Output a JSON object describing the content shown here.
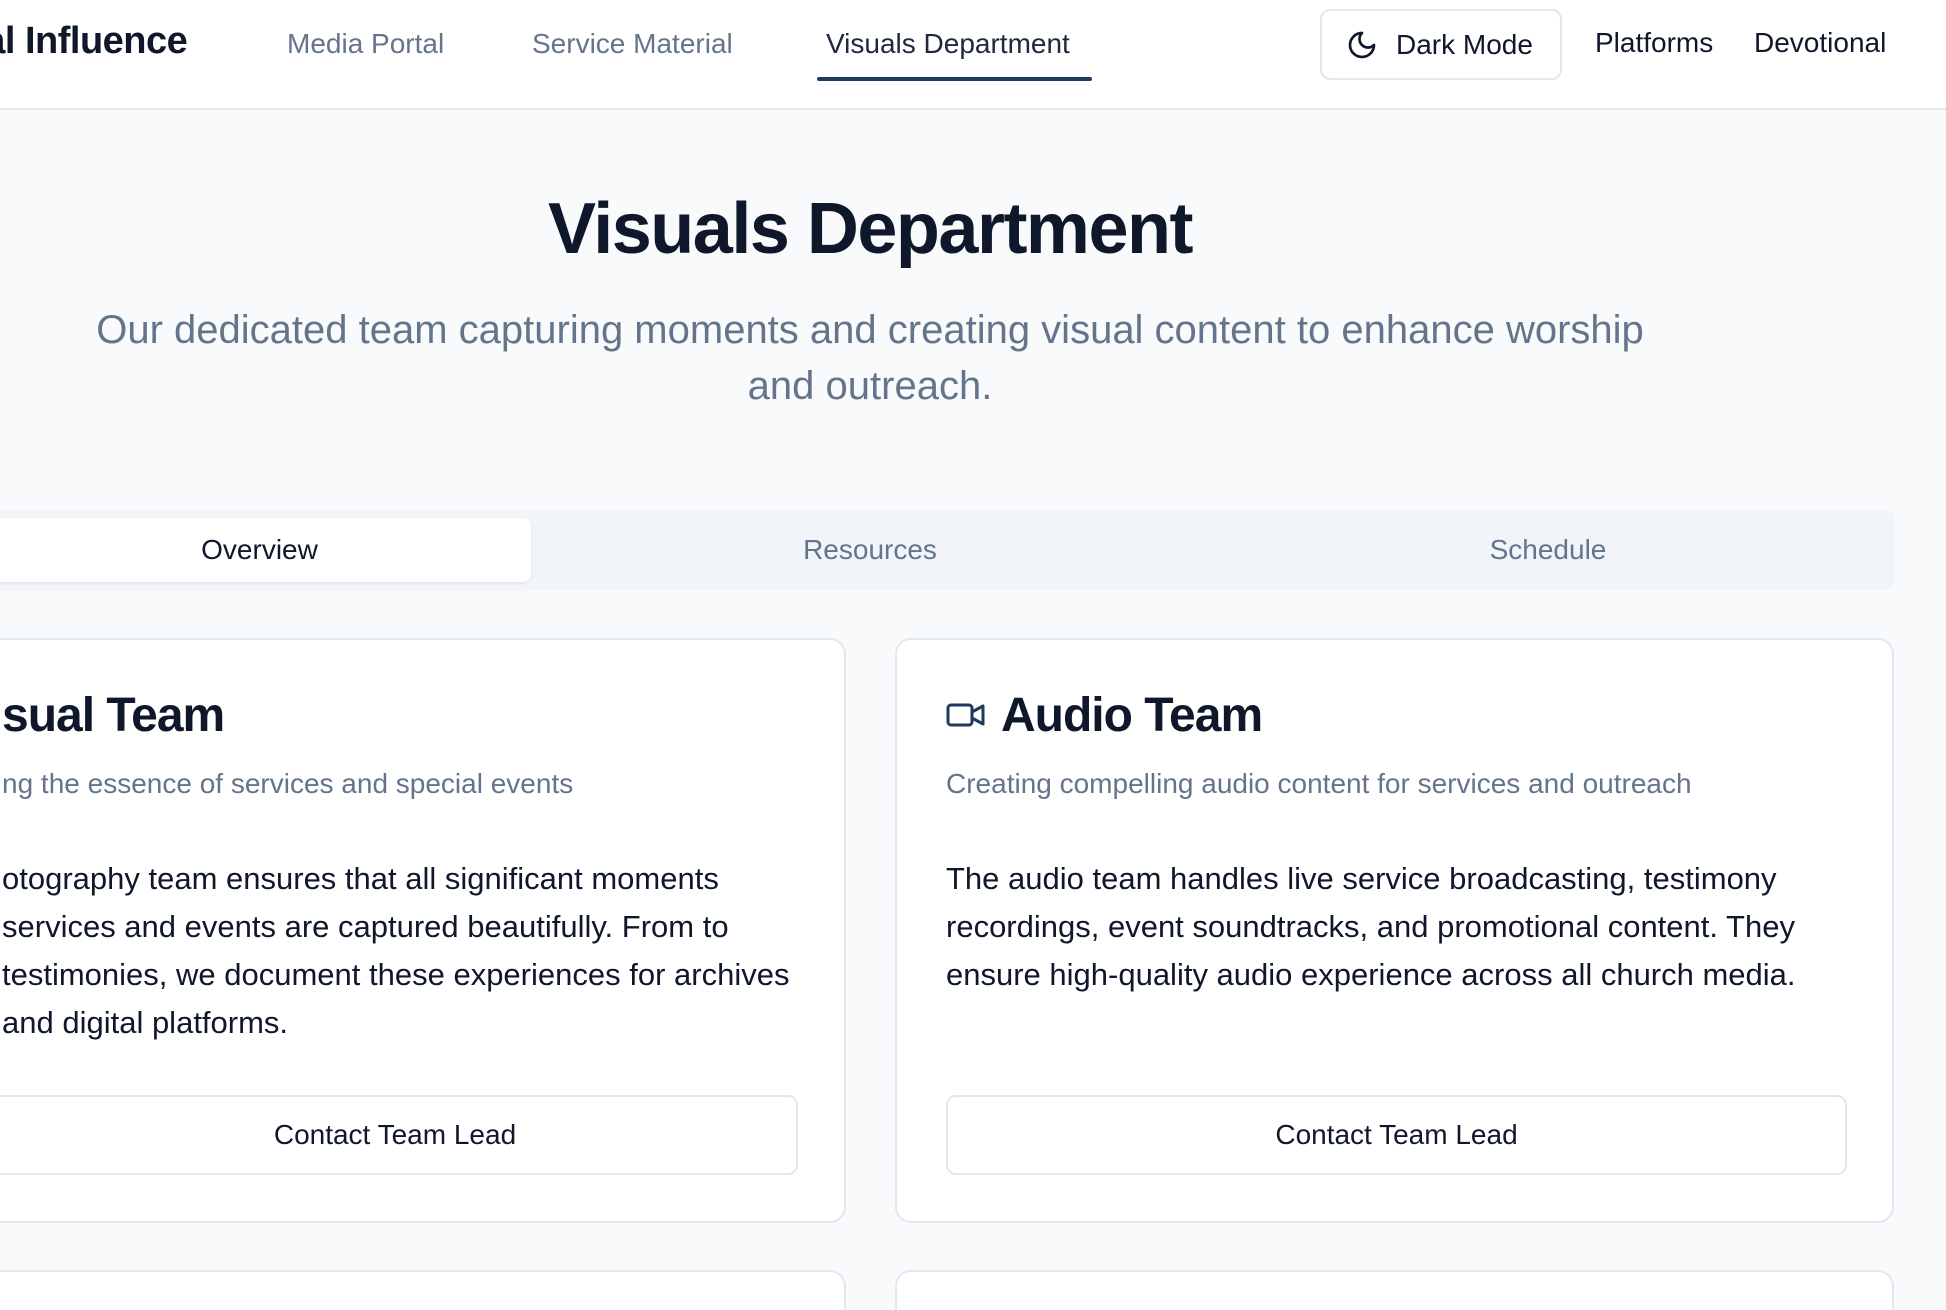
{
  "header": {
    "brand": "ital Influence",
    "nav": [
      {
        "label": "Media Portal"
      },
      {
        "label": "Service Material"
      },
      {
        "label": "Visuals Department"
      }
    ],
    "active_nav": "Visuals Department",
    "dark_mode_label": "Dark Mode",
    "links": [
      {
        "label": "Platforms"
      },
      {
        "label": "Devotional"
      }
    ]
  },
  "hero": {
    "title": "Visuals Department",
    "subtitle": "Our dedicated team capturing moments and creating visual content to enhance worship and outreach."
  },
  "tabs": [
    {
      "label": "Overview"
    },
    {
      "label": "Resources"
    },
    {
      "label": "Schedule"
    }
  ],
  "active_tab": "Overview",
  "cards": [
    {
      "title": "sual Team",
      "subtitle": "ng the essence of services and special events",
      "body": "otography team ensures that all significant moments services and events are captured beautifully. From to testimonies, we document these experiences for archives and digital platforms.",
      "button": "Contact Team Lead"
    },
    {
      "icon": "video-camera-icon",
      "title": "Audio Team",
      "subtitle": "Creating compelling audio content for services and outreach",
      "body": "The audio team handles live service broadcasting, testimony recordings, event soundtracks, and promotional content. They ensure high-quality audio experience across all church media.",
      "button": "Contact Team Lead"
    }
  ],
  "colors": {
    "accent": "#1e3a5f",
    "text": "#0f172a",
    "muted": "#64748b",
    "border": "#e2e8f0",
    "background": "#f8fafc"
  }
}
